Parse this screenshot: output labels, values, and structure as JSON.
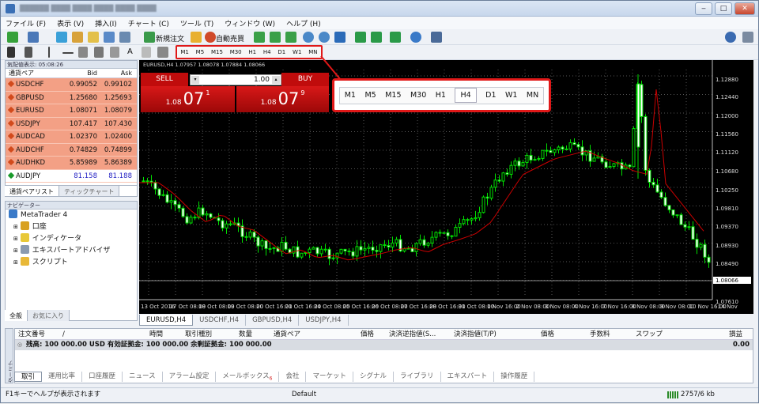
{
  "menubar": {
    "items": [
      "ファイル (F)",
      "表示 (V)",
      "挿入(I)",
      "チャート (C)",
      "ツール (T)",
      "ウィンドウ (W)",
      "ヘルプ (H)"
    ]
  },
  "toolbar": {
    "new_order_label": "新規注文",
    "autotrade_label": "自動売買",
    "timeframes": [
      "M1",
      "M5",
      "M15",
      "M30",
      "H1",
      "H4",
      "D1",
      "W1",
      "MN"
    ]
  },
  "market_watch": {
    "title": "気配値表示: 05:08:26",
    "headers": {
      "symbol": "通貨ペア",
      "bid": "Bid",
      "ask": "Ask"
    },
    "rows": [
      {
        "symbol": "USDCHF",
        "bid": "0.99052",
        "ask": "0.99102"
      },
      {
        "symbol": "GBPUSD",
        "bid": "1.25680",
        "ask": "1.25693"
      },
      {
        "symbol": "EURUSD",
        "bid": "1.08071",
        "ask": "1.08079"
      },
      {
        "symbol": "USDJPY",
        "bid": "107.417",
        "ask": "107.430"
      },
      {
        "symbol": "AUDCAD",
        "bid": "1.02370",
        "ask": "1.02400"
      },
      {
        "symbol": "AUDCHF",
        "bid": "0.74829",
        "ask": "0.74899"
      },
      {
        "symbol": "AUDHKD",
        "bid": "5.85989",
        "ask": "5.86389"
      },
      {
        "symbol": "AUDJPY",
        "bid": "81.158",
        "ask": "81.188"
      }
    ],
    "tabs": [
      "通貨ペアリスト",
      "ティックチャート"
    ]
  },
  "navigator": {
    "title": "ナビゲーター",
    "root": "MetaTrader 4",
    "items": [
      "口座",
      "インディケータ",
      "エキスパートアドバイザ",
      "スクリプト"
    ],
    "tabs": [
      "全般",
      "お気に入り"
    ]
  },
  "chart": {
    "header": "EURUSD,H4  1.07957 1.08078 1.07884 1.08066",
    "current_price": "1.08066",
    "y_ticks": [
      "1.12880",
      "1.12440",
      "1.12000",
      "1.11560",
      "1.11120",
      "1.10680",
      "1.10250",
      "1.09810",
      "1.09370",
      "1.08930",
      "1.08490",
      "1.07610"
    ],
    "x_ticks": [
      "13 Oct 2016",
      "17 Oct 08:00",
      "18 Oct 08:00",
      "19 Oct 08:00",
      "20 Oct 16:00",
      "21 Oct 16:00",
      "24 Oct 08:00",
      "25 Oct 16:00",
      "26 Oct 08:00",
      "27 Oct 16:00",
      "28 Oct 16:00",
      "31 Oct 08:00",
      "1 Nov 16:00",
      "2 Nov 08:00",
      "3 Nov 08:00",
      "4 Nov 16:00",
      "7 Nov 16:00",
      "8 Nov 08:00",
      "9 Nov 08:00",
      "10 Nov 16:00",
      "14 Nov"
    ],
    "tabs": [
      "EURUSD,H4",
      "USDCHF,H4",
      "GBPUSD,H4",
      "USDJPY,H4"
    ]
  },
  "one_click": {
    "sell_label": "SELL",
    "buy_label": "BUY",
    "lot": "1.00",
    "sell_small": "1.08",
    "sell_big": "07",
    "sell_pip": "1",
    "buy_small": "1.08",
    "buy_big": "07",
    "buy_pip": "9"
  },
  "terminal": {
    "headers": [
      "注文番号",
      "/",
      "時間",
      "取引種別",
      "数量",
      "通貨ペア",
      "価格",
      "決済逆指値(S...",
      "決済指値(T/P)",
      "価格",
      "手数料",
      "スワップ",
      "損益"
    ],
    "balance_line": "残高: 100 000.00 USD  有効証拠金: 100 000.00  余剰証拠金: 100 000.00",
    "balance_pnl": "0.00",
    "side_label": "ターミナル",
    "tabs": [
      "取引",
      "運用比率",
      "口座履歴",
      "ニュース",
      "アラーム設定",
      "メールボックス",
      "会社",
      "マーケット",
      "シグナル",
      "ライブラリ",
      "エキスパート",
      "操作履歴"
    ],
    "mailbox_badge": "6"
  },
  "statusbar": {
    "help": "F1キーでヘルプが表示されます",
    "profile": "Default",
    "traffic": "2757/6 kb"
  },
  "colors": {
    "quote_row_bg": "#f3a085",
    "trade_red": "#c00c0c",
    "candle_green": "#00e000",
    "ma_line": "#cc0000"
  }
}
